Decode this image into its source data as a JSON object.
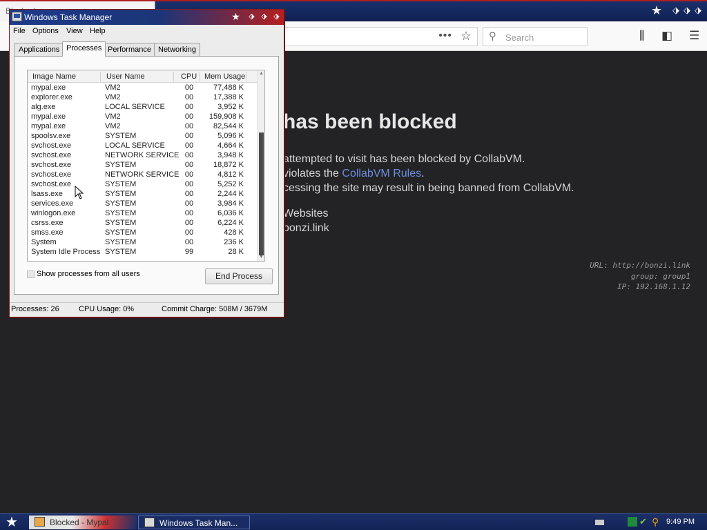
{
  "browser": {
    "tab_title": "Blocked",
    "search_placeholder": "Search",
    "blocked_title": "has been blocked",
    "blocked_line1": "attempted to visit has been blocked by CollabVM.",
    "blocked_line2_prefix": "violates the ",
    "blocked_line2_link": "CollabVM Rules",
    "blocked_line2_suffix": ".",
    "blocked_line3": "cessing the site may result in being banned from CollabVM.",
    "blocked_line4": "Websites",
    "blocked_line5": "bonzi.link",
    "meta_url": "URL: http://bonzi.link",
    "meta_group": "group: group1",
    "meta_ip": "IP: 192.168.1.12"
  },
  "taskmanager": {
    "title": "Windows Task Manager",
    "menus": [
      "File",
      "Options",
      "View",
      "Help"
    ],
    "tabs": [
      "Applications",
      "Processes",
      "Performance",
      "Networking"
    ],
    "columns": [
      "Image Name",
      "User Name",
      "CPU",
      "Mem Usage"
    ],
    "processes": [
      {
        "name": "mypal.exe",
        "user": "VM2",
        "cpu": "00",
        "mem": "77,488 K"
      },
      {
        "name": "explorer.exe",
        "user": "VM2",
        "cpu": "00",
        "mem": "17,388 K"
      },
      {
        "name": "alg.exe",
        "user": "LOCAL SERVICE",
        "cpu": "00",
        "mem": "3,952 K"
      },
      {
        "name": "mypal.exe",
        "user": "VM2",
        "cpu": "00",
        "mem": "159,908 K"
      },
      {
        "name": "mypal.exe",
        "user": "VM2",
        "cpu": "00",
        "mem": "82,544 K"
      },
      {
        "name": "spoolsv.exe",
        "user": "SYSTEM",
        "cpu": "00",
        "mem": "5,096 K"
      },
      {
        "name": "svchost.exe",
        "user": "LOCAL SERVICE",
        "cpu": "00",
        "mem": "4,664 K"
      },
      {
        "name": "svchost.exe",
        "user": "NETWORK SERVICE",
        "cpu": "00",
        "mem": "3,948 K"
      },
      {
        "name": "svchost.exe",
        "user": "SYSTEM",
        "cpu": "00",
        "mem": "18,872 K"
      },
      {
        "name": "svchost.exe",
        "user": "NETWORK SERVICE",
        "cpu": "00",
        "mem": "4,812 K"
      },
      {
        "name": "svchost.exe",
        "user": "SYSTEM",
        "cpu": "00",
        "mem": "5,252 K"
      },
      {
        "name": "lsass.exe",
        "user": "SYSTEM",
        "cpu": "00",
        "mem": "2,244 K"
      },
      {
        "name": "services.exe",
        "user": "SYSTEM",
        "cpu": "00",
        "mem": "3,984 K"
      },
      {
        "name": "winlogon.exe",
        "user": "SYSTEM",
        "cpu": "00",
        "mem": "6,036 K"
      },
      {
        "name": "csrss.exe",
        "user": "SYSTEM",
        "cpu": "00",
        "mem": "6,224 K"
      },
      {
        "name": "smss.exe",
        "user": "SYSTEM",
        "cpu": "00",
        "mem": "428 K"
      },
      {
        "name": "System",
        "user": "SYSTEM",
        "cpu": "00",
        "mem": "236 K"
      },
      {
        "name": "System Idle Process",
        "user": "SYSTEM",
        "cpu": "99",
        "mem": "28 K"
      }
    ],
    "show_all_label": "Show processes from all users",
    "end_process_label": "End Process",
    "status_processes": "Processes: 26",
    "status_cpu": "CPU Usage: 0%",
    "status_commit": "Commit Charge: 508M / 3679M"
  },
  "taskbar": {
    "browser_task_label": "Blocked - Mypal",
    "tm_task_label": "Windows Task Man...",
    "clock": "9:49 PM"
  },
  "colors": {
    "titlebar_blue": "#1e3a8a",
    "titlebar_red": "#b52020",
    "link_blue": "#6b8fe0",
    "page_background": "#232325"
  }
}
